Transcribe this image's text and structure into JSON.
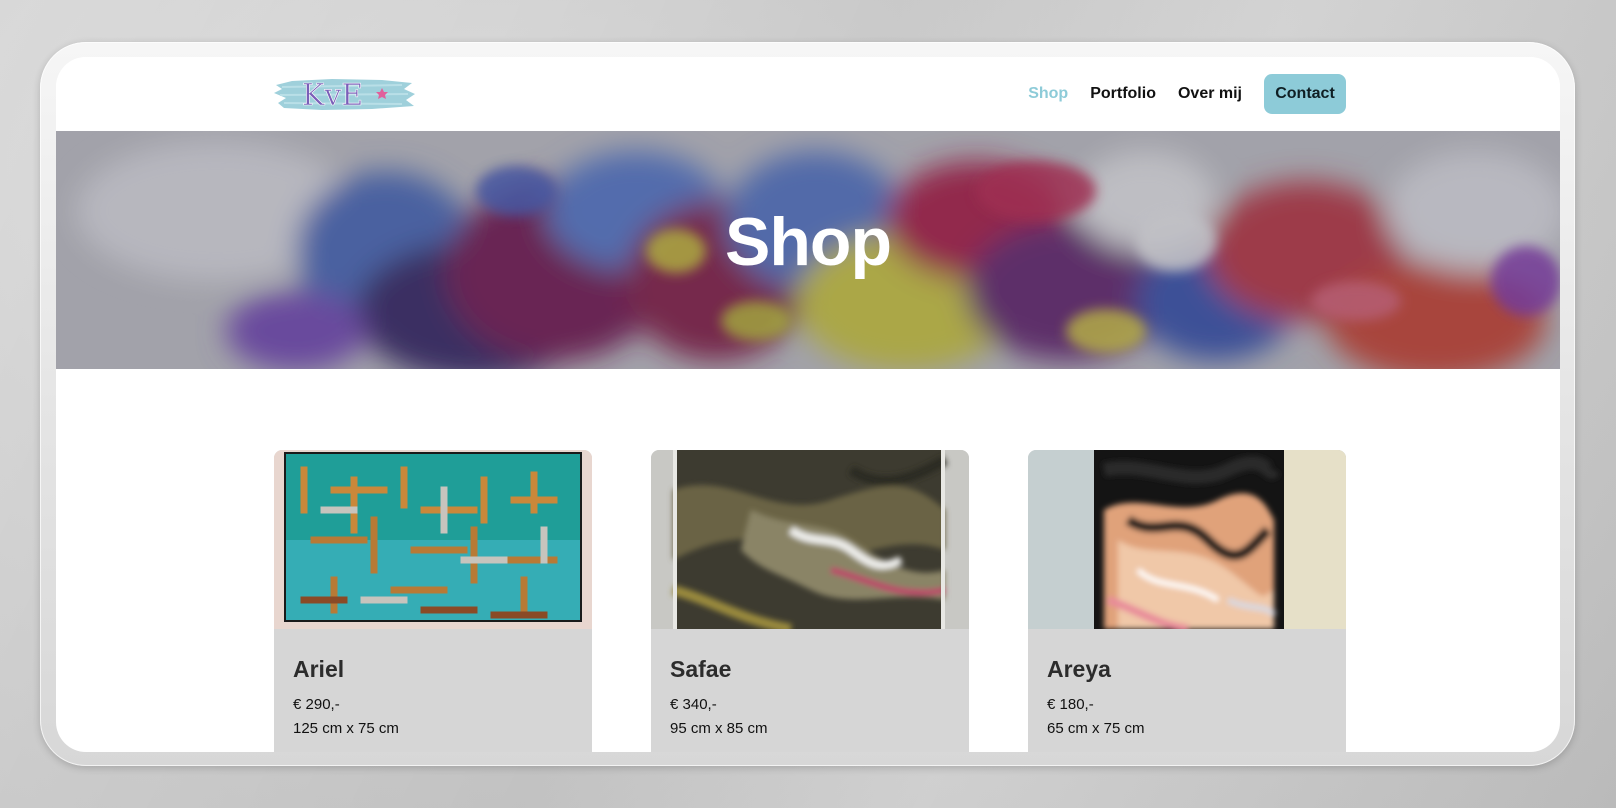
{
  "brand": {
    "logo_text": "KvE",
    "accent": "#8dcbd8"
  },
  "nav": {
    "items": [
      {
        "label": "Shop",
        "active": true
      },
      {
        "label": "Portfolio",
        "active": false
      },
      {
        "label": "Over mij",
        "active": false
      }
    ],
    "contact_label": "Contact"
  },
  "hero": {
    "title": "Shop"
  },
  "products": [
    {
      "name": "Ariel",
      "price": "€ 290,-",
      "size": "125 cm x 75 cm"
    },
    {
      "name": "Safae",
      "price": "€ 340,-",
      "size": "95 cm x 85 cm"
    },
    {
      "name": "Areya",
      "price": "€ 180,-",
      "size": "65 cm x 75 cm"
    }
  ]
}
